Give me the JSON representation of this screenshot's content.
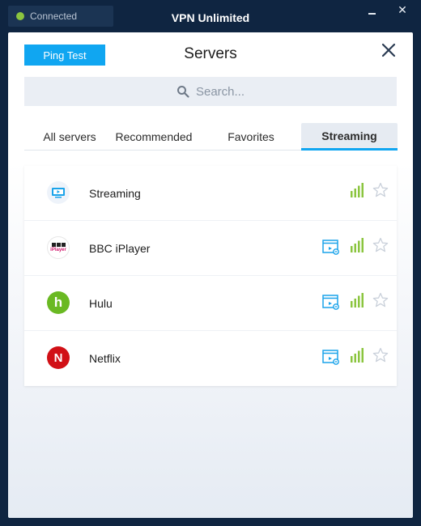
{
  "titlebar": {
    "connection_status": "Connected",
    "app_title": "VPN Unlimited",
    "minimize_icon": "minimize-icon",
    "close_icon": "close-icon"
  },
  "panel": {
    "ping_test_label": "Ping Test",
    "title": "Servers",
    "search_placeholder": "Search..."
  },
  "tabs": [
    {
      "label": "All servers",
      "active": false
    },
    {
      "label": "Recommended",
      "active": false
    },
    {
      "label": "Favorites",
      "active": false
    },
    {
      "label": "Streaming",
      "active": true
    }
  ],
  "servers": [
    {
      "name": "Streaming",
      "logo": "streaming-icon",
      "has_stream_link": false,
      "signal": "full",
      "favorite": false
    },
    {
      "name": "BBC iPlayer",
      "logo": "bbc-iplayer-logo",
      "logo_text": "iPlayer",
      "has_stream_link": true,
      "signal": "full",
      "favorite": false
    },
    {
      "name": "Hulu",
      "logo": "hulu-logo",
      "logo_text": "h",
      "has_stream_link": true,
      "signal": "full",
      "favorite": false
    },
    {
      "name": "Netflix",
      "logo": "netflix-logo",
      "logo_text": "N",
      "has_stream_link": true,
      "signal": "full",
      "favorite": false
    }
  ],
  "colors": {
    "accent": "#10a6f1",
    "connected": "#8bc53f",
    "signal": "#8bc53f",
    "background": "#0f2541"
  }
}
